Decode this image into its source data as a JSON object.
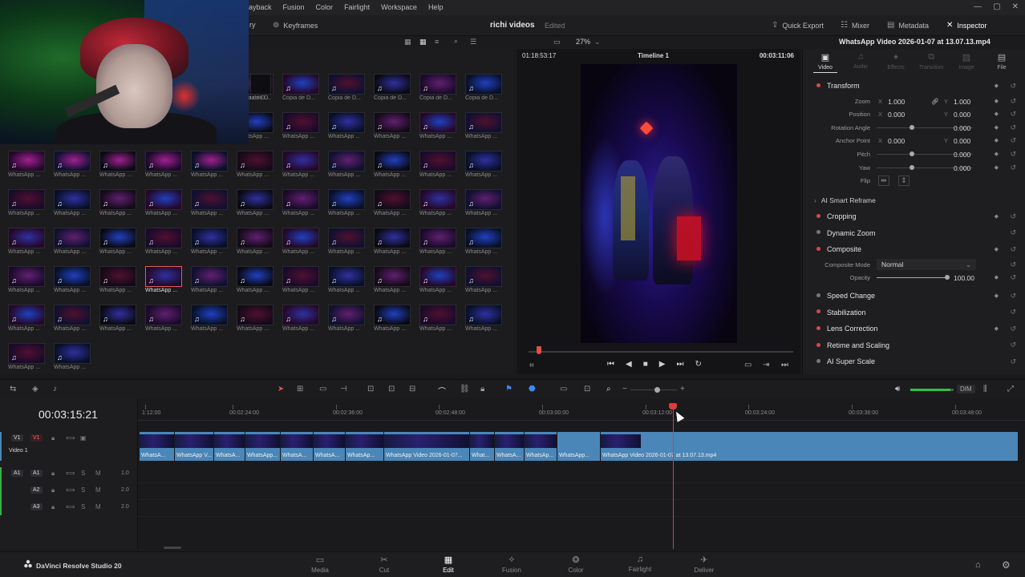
{
  "menubar": {
    "items": [
      "ayback",
      "Fusion",
      "Color",
      "Fairlight",
      "Workspace",
      "Help"
    ]
  },
  "toolbar": {
    "partial_left": "ry",
    "keyframes": "Keyframes",
    "project_title": "richi videos",
    "project_status": "Edited",
    "quick_export": "Quick Export",
    "mixer": "Mixer",
    "metadata": "Metadata",
    "inspector": "Inspector"
  },
  "subheader": {
    "zoom": "27%",
    "clip_name": "WhatsApp Video 2026-01-07 at 13.07.13.mp4"
  },
  "media_pool": {
    "rows": [
      [
        "Copia de D...",
        "Copia de D...",
        "Copia de D...",
        "Copia de D...",
        "Copia de D...",
        "Copia de D..."
      ],
      [
        "WhatsApp ...",
        "WhatsApp ...",
        "WhatsApp ...",
        "WhatsApp ...",
        "WhatsApp ...",
        "WhatsApp ..."
      ],
      [
        "WhatsApp ...",
        "WhatsApp ...",
        "WhatsApp ...",
        "WhatsApp ...",
        "WhatsApp ...",
        "WhatsApp ...",
        "WhatsApp ...",
        "WhatsApp ...",
        "WhatsApp ...",
        "WhatsApp ...",
        "WhatsApp ..."
      ],
      [
        "WhatsApp ...",
        "WhatsApp ...",
        "WhatsApp ...",
        "WhatsApp ...",
        "WhatsApp ...",
        "WhatsApp ...",
        "WhatsApp ...",
        "WhatsApp ...",
        "WhatsApp ...",
        "WhatsApp ...",
        "WhatsApp ..."
      ],
      [
        "WhatsApp ...",
        "WhatsApp ...",
        "WhatsApp ...",
        "WhatsApp ...",
        "WhatsApp ...",
        "WhatsApp ...",
        "WhatsApp ...",
        "WhatsApp ...",
        "WhatsApp ...",
        "WhatsApp ...",
        "WhatsApp ..."
      ],
      [
        "WhatsApp ...",
        "WhatsApp ...",
        "WhatsApp ...",
        "WhatsApp ...",
        "WhatsApp ...",
        "WhatsApp ...",
        "WhatsApp ...",
        "WhatsApp ...",
        "WhatsApp ...",
        "WhatsApp ...",
        "WhatsApp ..."
      ],
      [
        "WhatsApp ...",
        "WhatsApp ...",
        "WhatsApp ...",
        "WhatsApp ...",
        "WhatsApp ...",
        "WhatsApp ...",
        "WhatsApp ...",
        "WhatsApp ...",
        "WhatsApp ...",
        "WhatsApp ...",
        "WhatsApp ..."
      ],
      [
        "WhatsApp ...",
        "WhatsApp ..."
      ]
    ],
    "partial_label": "ia de D...",
    "selected_row": 5,
    "selected_col": 3
  },
  "viewer": {
    "timecode_left": "01:18:53:17",
    "timeline_name": "Timeline 1",
    "timecode_right": "00:03:11:06"
  },
  "inspector": {
    "tabs": [
      "Video",
      "Audio",
      "Effects",
      "Transition",
      "Image",
      "File"
    ],
    "transform": "Transform",
    "zoom_label": "Zoom",
    "zoom_x": "1.000",
    "zoom_y": "1.000",
    "position_label": "Position",
    "position_x": "0.000",
    "position_y": "0.000",
    "rotation_label": "Rotation Angle",
    "rotation": "0.000",
    "anchor_label": "Anchor Point",
    "anchor_x": "0.000",
    "anchor_y": "0.000",
    "pitch_label": "Pitch",
    "pitch": "0.000",
    "yaw_label": "Yaw",
    "yaw": "0.000",
    "flip_label": "Flip",
    "ai_smart_reframe": "AI Smart Reframe",
    "cropping": "Cropping",
    "dynamic_zoom": "Dynamic Zoom",
    "composite": "Composite",
    "composite_mode_label": "Composite Mode",
    "composite_mode": "Normal",
    "opacity_label": "Opacity",
    "opacity": "100.00",
    "speed_change": "Speed Change",
    "stabilization": "Stabilization",
    "lens_correction": "Lens Correction",
    "retime_scaling": "Retime and Scaling",
    "ai_super_scale": "AI Super Scale",
    "axis_x": "X",
    "axis_y": "Y"
  },
  "timeline_toolbar": {
    "dim": "DIM"
  },
  "timeline": {
    "timecode": "00:03:15:21",
    "ruler": [
      "1:12:00",
      "00:02:24:00",
      "00:02:36:00",
      "00:02:48:00",
      "00:03:00:00",
      "00:03:12:00",
      "00:03:24:00",
      "00:03:36:00",
      "00:03:48:00"
    ],
    "video_track": {
      "badge": "V1",
      "name": "Video 1"
    },
    "audio_tracks": [
      {
        "badge": "A1",
        "vol": "1.0"
      },
      {
        "badge": "A2",
        "vol": "2.0"
      },
      {
        "badge": "A3",
        "vol": "2.0"
      }
    ],
    "track_letters": {
      "s": "S",
      "m": "M"
    },
    "clips": [
      "WhatsA...",
      "WhatsApp V...",
      "WhatsA...",
      "WhatsApp...",
      "WhatsA...",
      "WhatsA...",
      "WhatsAp...",
      "WhatsApp Video 2026-01-07...",
      "What...",
      "WhatsA...",
      "WhatsAp...",
      "WhatsApp...",
      "WhatsApp Video 2026-01-07 at 13.07.13.mp4"
    ]
  },
  "pagebar": {
    "app_name": "DaVinci Resolve Studio 20",
    "tabs": [
      "Media",
      "Cut",
      "Edit",
      "Fusion",
      "Color",
      "Fairlight",
      "Deliver"
    ],
    "active_tab": "Edit"
  }
}
